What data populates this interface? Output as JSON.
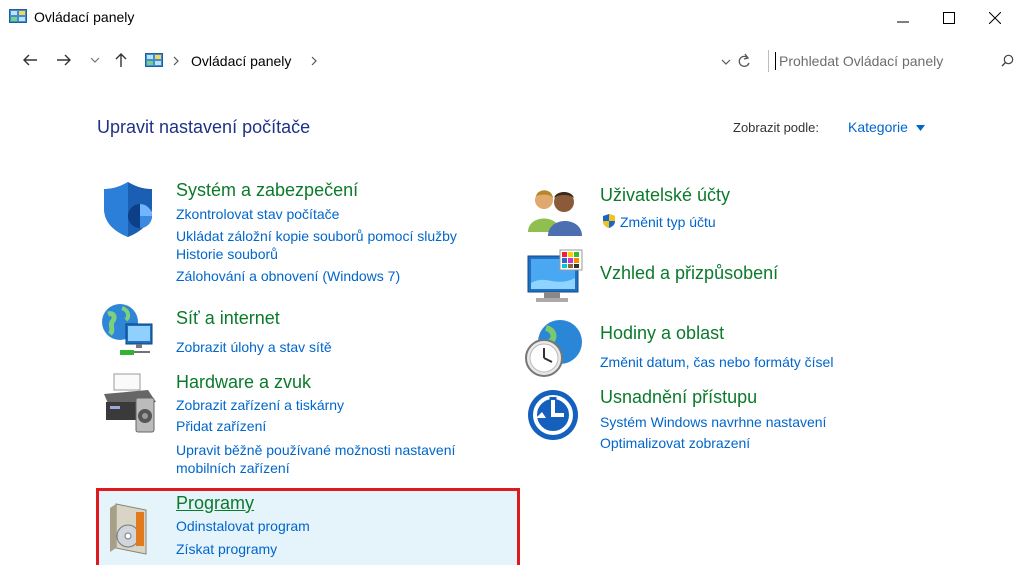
{
  "window": {
    "title": "Ovládací panely"
  },
  "nav": {
    "breadcrumb": [
      "Ovládací panely"
    ],
    "search_placeholder": "Prohledat Ovládací panely"
  },
  "main": {
    "heading": "Upravit nastavení počítače",
    "view_by_label": "Zobrazit podle:",
    "view_by_value": "Kategorie"
  },
  "categories": [
    {
      "title": "Systém a zabezpečení",
      "links": [
        "Zkontrolovat stav počítače",
        "Ukládat záložní kopie souborů pomocí služby",
        "Historie souborů",
        "Zálohování a obnovení (Windows 7)"
      ],
      "icon": "shield-icon"
    },
    {
      "title": "Síť a internet",
      "links": [
        "Zobrazit úlohy a stav sítě"
      ],
      "icon": "network-globe-icon"
    },
    {
      "title": "Hardware a zvuk",
      "links": [
        "Zobrazit zařízení a tiskárny",
        "Přidat zařízení",
        "Upravit běžně používané možnosti nastavení",
        "mobilních zařízení"
      ],
      "icon": "printer-icon"
    },
    {
      "title": "Programy",
      "links": [
        "Odinstalovat program",
        "Získat programy"
      ],
      "icon": "programs-disc-icon"
    },
    {
      "title": "Uživatelské účty",
      "links": [
        "Změnit typ účtu"
      ],
      "icon": "users-icon"
    },
    {
      "title": "Vzhled a přizpůsobení",
      "links": [],
      "icon": "monitor-palette-icon"
    },
    {
      "title": "Hodiny a oblast",
      "links": [
        "Změnit datum, čas nebo formáty čísel"
      ],
      "icon": "clock-globe-icon"
    },
    {
      "title": "Usnadnění přístupu",
      "links": [
        "Systém Windows navrhne nastavení",
        "Optimalizovat zobrazení"
      ],
      "icon": "ease-of-access-icon"
    }
  ],
  "colors": {
    "category_title": "#0b7a2b",
    "link": "#0066cc",
    "heading": "#1e3287",
    "highlight_border": "#e0191f",
    "highlight_bg": "#e5f3fb"
  }
}
